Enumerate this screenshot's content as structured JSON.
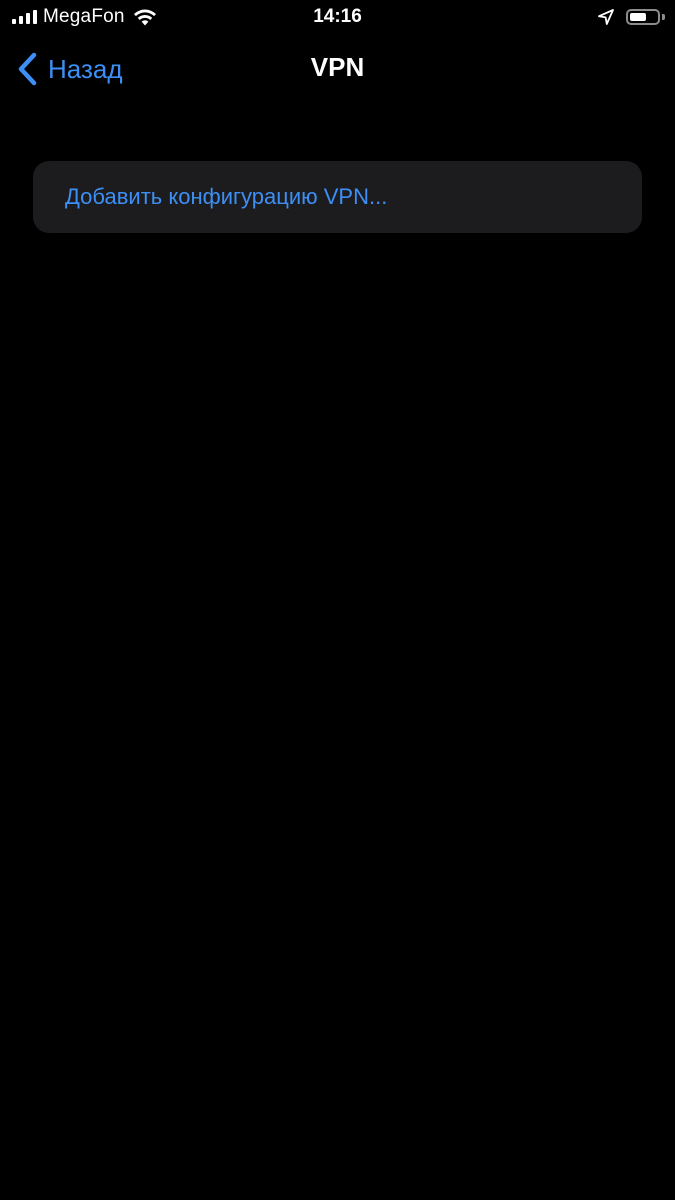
{
  "status_bar": {
    "carrier": "MegaFon",
    "time": "14:16",
    "battery_level": 0.6,
    "icons": [
      "signal-icon",
      "wifi-icon",
      "location-arrow-icon",
      "battery-icon"
    ]
  },
  "nav": {
    "back_label": "Назад",
    "title": "VPN"
  },
  "content": {
    "add_vpn_label": "Добавить конфигурацию VPN..."
  },
  "colors": {
    "background": "#000000",
    "group_background": "#1c1c1e",
    "accent": "#3d8ff5",
    "text": "#ffffff"
  }
}
